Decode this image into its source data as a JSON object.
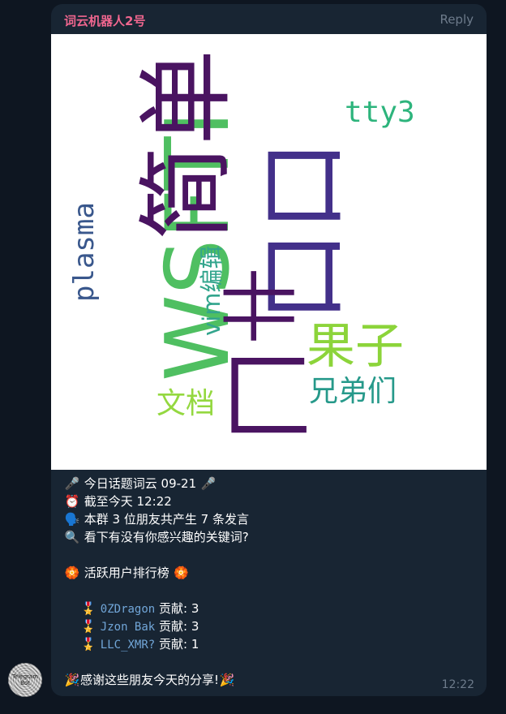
{
  "sender": "词云机器人2号",
  "reply_label": "Reply",
  "avatar_label": "Telegram Bot",
  "wordcloud": {
    "words": [
      {
        "text": "WSFTI",
        "color": "#4fbf61"
      },
      {
        "text": "简单",
        "color": "#4a1461"
      },
      {
        "text": "口口",
        "color": "#43308a"
      },
      {
        "text": "果子",
        "color": "#8cd43a"
      },
      {
        "text": "文档",
        "color": "#94d840"
      },
      {
        "text": "兄弟们",
        "color": "#26998a"
      },
      {
        "text": "tty3",
        "color": "#2db47c"
      },
      {
        "text": "vim编辑",
        "color": "#33a58d"
      },
      {
        "text": "plasma",
        "color": "#39578c"
      },
      {
        "text": "匚",
        "color": "#4a1461"
      },
      {
        "text": "卄",
        "color": "#4a1461"
      }
    ]
  },
  "message": {
    "line1": {
      "emoji": "🎤",
      "text": "今日话题词云 09-21",
      "emoji_end": "🎤"
    },
    "line2": {
      "emoji": "⏰",
      "text": "截至今天 12:22"
    },
    "line3": {
      "emoji": "🗣️",
      "text": "本群 3 位朋友共产生 7 条发言"
    },
    "line4": {
      "emoji": "🔍",
      "text": "看下有没有你感兴趣的关键词?"
    },
    "rank_title": {
      "emoji": "🏵️",
      "text": "活跃用户排行榜",
      "emoji_end": "🏵️"
    },
    "users": [
      {
        "medal": "🎖️",
        "name": "0ZDragon",
        "label": "贡献:",
        "count": "3"
      },
      {
        "medal": "🎖️",
        "name": "Jzon Bak",
        "label": "贡献:",
        "count": "3"
      },
      {
        "medal": "🎖️",
        "name": "LLC_XMR?",
        "label": "贡献:",
        "count": "1"
      }
    ],
    "thanks": {
      "emoji": "🎉",
      "text": "感谢这些朋友今天的分享!",
      "emoji_end": "🎉"
    }
  },
  "time": "12:22"
}
